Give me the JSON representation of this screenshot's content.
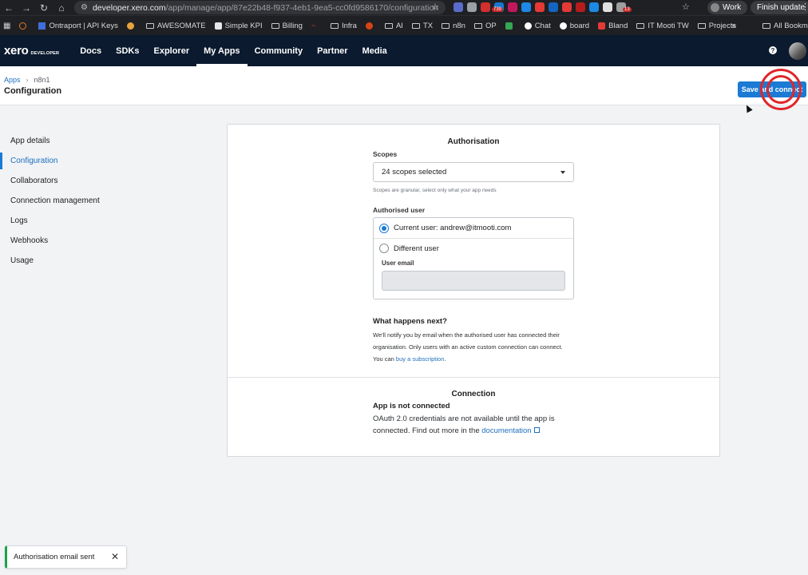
{
  "browser": {
    "url_host": "developer.xero.com",
    "url_path": "/app/manage/app/87e22b48-f937-4eb1-9ea5-cc0fd9586170/configuration",
    "extension_badge_1": "739",
    "extension_badge_2": "13",
    "profile_label": "Work",
    "finish_update_label": "Finish update"
  },
  "bookmarks": {
    "items": [
      "Ontraport | API Keys",
      "AWESOMATE",
      "Simple KPI",
      "Billing",
      "Infra",
      "AI",
      "TX",
      "n8n",
      "OP",
      "Chat",
      "board",
      "Bland",
      "IT Mooti TW",
      "Projects"
    ],
    "all_label": "All Bookmarks",
    "more_label": "»"
  },
  "xero_nav": {
    "logo_main": "xero",
    "logo_sub": "DEVELOPER",
    "links": [
      "Docs",
      "SDKs",
      "Explorer",
      "My Apps",
      "Community",
      "Partner",
      "Media"
    ],
    "active": "My Apps",
    "help_glyph": "?"
  },
  "page_header": {
    "breadcrumb_root": "Apps",
    "breadcrumb_sep": "›",
    "breadcrumb_current": "n8n1",
    "title": "Configuration",
    "primary_button": "Save and connect"
  },
  "sidebar": {
    "items": [
      "App details",
      "Configuration",
      "Collaborators",
      "Connection management",
      "Logs",
      "Webhooks",
      "Usage"
    ],
    "active": "Configuration"
  },
  "authorisation": {
    "title": "Authorisation",
    "scopes_label": "Scopes",
    "scopes_value": "24 scopes selected",
    "scopes_hint": "Scopes are granular, select only what your app needs",
    "authorised_user_label": "Authorised user",
    "option_current": "Current user: andrew@itmooti.com",
    "option_different": "Different user",
    "user_email_label": "User email",
    "user_email_value": "",
    "selected_option": "current",
    "password_manager_glyph": "•••",
    "next_title": "What happens next?",
    "next_body": "We'll notify you by email when the authorised user has connected their organisation. Only users with an active custom connection can connect. You can ",
    "next_link": "buy a subscription",
    "next_tail": "."
  },
  "connection": {
    "title": "Connection",
    "status": "App is not connected",
    "body": "OAuth 2.0 credentials are not available until the app is connected. Find out more in the ",
    "link": "documentation"
  },
  "toast": {
    "message": "Authorisation email sent",
    "close_glyph": "✕"
  },
  "colors": {
    "brand_nav": "#0b1a2e",
    "primary": "#1a7ad4",
    "success": "#1aa34a",
    "click_highlight": "#e0262a"
  }
}
